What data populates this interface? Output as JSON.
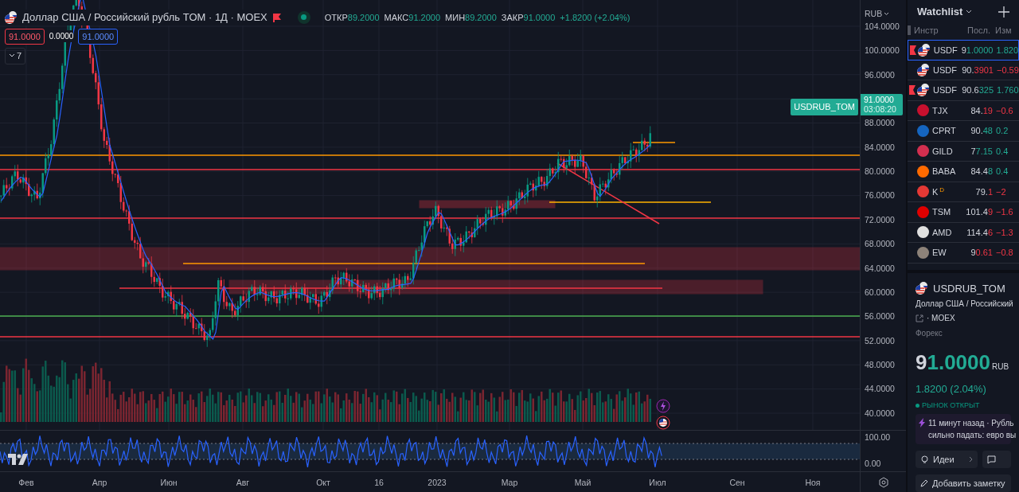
{
  "legend": {
    "title": "Доллар США / Российский рубль TOM · 1Д · MOEX",
    "flagged": true,
    "market_open": true,
    "ohlc": [
      {
        "label": "ОТКР",
        "value": "89.2000"
      },
      {
        "label": "МАКС",
        "value": "91.2000"
      },
      {
        "label": "МИН",
        "value": "89.2000"
      },
      {
        "label": "ЗАКР",
        "value": "91.0000"
      }
    ],
    "change": "+1.8200 (+2.04%)",
    "inputs": [
      {
        "kind": "boxed",
        "value": "91.0000",
        "color": "#f23645"
      },
      {
        "kind": "plain",
        "value": "0.0000"
      },
      {
        "kind": "boxed",
        "value": "91.0000",
        "color": "#2962ff"
      }
    ],
    "collapsed_count": "7"
  },
  "last_price": {
    "symbol": "USDRUB_TOM",
    "price": "91.0000",
    "countdown": "03:08:20"
  },
  "price_axis": {
    "currency": "RUB",
    "ticks_above": [
      "104.0000",
      "100.0000",
      "96.0000"
    ],
    "ticks_below": [
      "88.0000",
      "84.0000",
      "80.0000",
      "76.0000",
      "72.0000",
      "68.0000",
      "64.0000",
      "60.0000",
      "56.0000",
      "52.0000",
      "48.0000",
      "44.0000",
      "40.0000"
    ]
  },
  "indicator_axis": {
    "ticks": [
      "100.00",
      "0.00"
    ]
  },
  "time_axis": [
    "Фев",
    "Апр",
    "Июн",
    "Авг",
    "Окт",
    "16",
    "2023",
    "Мар",
    "Май",
    "Июл",
    "Сен",
    "Ноя"
  ],
  "watchlist": {
    "title": "Watchlist",
    "columns": [
      "Инстр",
      "Посл.",
      "Изм"
    ],
    "rows": [
      {
        "kind": "forex",
        "symbol": "USDF",
        "last_head": "9",
        "last_tail": "1.0000",
        "change": "1.820",
        "rising": true,
        "flagged": true,
        "selected": true
      },
      {
        "kind": "forex",
        "symbol": "USDF",
        "last_head": "90.",
        "last_tail": "3901",
        "change": "−0.59",
        "rising": false,
        "flagged": false,
        "selected": false
      },
      {
        "kind": "forex",
        "symbol": "USDF",
        "last_head": "90.6",
        "last_tail": "325",
        "change": "1.760",
        "rising": true,
        "flagged": true,
        "selected": false
      },
      {
        "kind": "stock",
        "symbol": "TJX",
        "last_head": "84.",
        "last_tail": "19",
        "change": "−0.6",
        "rising": false,
        "flagged": false,
        "selected": false,
        "color": "#c8102e"
      },
      {
        "kind": "stock",
        "symbol": "CPRT",
        "last_head": "90.",
        "last_tail": "48",
        "change": "0.2",
        "rising": true,
        "flagged": false,
        "selected": false,
        "color": "#1565c0"
      },
      {
        "kind": "stock",
        "symbol": "GILD",
        "last_head": "7",
        "last_tail": "7.15",
        "change": "0.4",
        "rising": true,
        "flagged": false,
        "selected": false,
        "color": "#d32f4f"
      },
      {
        "kind": "stock",
        "symbol": "BABA",
        "last_head": "84.4",
        "last_tail": "8",
        "change": "0.4",
        "rising": true,
        "flagged": false,
        "selected": false,
        "color": "#ff6a00"
      },
      {
        "kind": "stock",
        "symbol": "K",
        "badge": "D",
        "last_head": "79.",
        "last_tail": "1",
        "change": "−2",
        "rising": false,
        "flagged": false,
        "selected": false,
        "color": "#e53935"
      },
      {
        "kind": "stock",
        "symbol": "TSM",
        "last_head": "101.4",
        "last_tail": "9",
        "change": "−1.6",
        "rising": false,
        "flagged": false,
        "selected": false,
        "color": "#e00000"
      },
      {
        "kind": "stock",
        "symbol": "AMD",
        "last_head": "114.4",
        "last_tail": "6",
        "change": "−1.3",
        "rising": false,
        "flagged": false,
        "selected": false,
        "color": "#e0e0e0"
      },
      {
        "kind": "stock",
        "symbol": "EW",
        "last_head": "9",
        "last_tail": "0.61",
        "change": "−0.8",
        "rising": false,
        "flagged": false,
        "selected": false,
        "color": "#8d8279"
      }
    ]
  },
  "details": {
    "symbol": "USDRUB_TOM",
    "name": "Доллар США / Российский",
    "exchange": "· MOEX",
    "category": "Форекс",
    "price_head": "9",
    "price_tail": "1.0000",
    "currency": "RUB",
    "change": "1.8200 (2.04%)",
    "status": "РЫНОК ОТКРЫТ",
    "market_open": true,
    "news": [
      "11 минут назад · Рубль",
      "сильно падать: евро вы"
    ],
    "ideas_button": "Идеи",
    "note_button": "Добавить заметку"
  }
}
